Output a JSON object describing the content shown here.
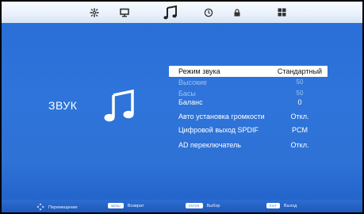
{
  "tabs": [
    {
      "icon": "gear-icon"
    },
    {
      "icon": "monitor-icon"
    },
    {
      "icon": "music-note-icon"
    },
    {
      "icon": "clock-icon"
    },
    {
      "icon": "lock-icon"
    },
    {
      "icon": "windows-grid-icon"
    }
  ],
  "section": {
    "title": "ЗВУК",
    "icon": "music-note-icon"
  },
  "menu": [
    {
      "label": "Режим звука",
      "value": "Стандартный",
      "selected": true,
      "dim": false
    },
    {
      "label": "Высокие",
      "value": "50",
      "selected": false,
      "dim": true
    },
    {
      "label": "Басы",
      "value": "50",
      "selected": false,
      "dim": true
    },
    {
      "label": "Баланс",
      "value": "0",
      "selected": false,
      "dim": false
    },
    {
      "label": "Авто установка громкости",
      "value": "Откл.",
      "selected": false,
      "dim": false
    },
    {
      "label": "Цифровой выход SPDIF",
      "value": "PCM",
      "selected": false,
      "dim": false
    },
    {
      "label": "AD переключатель",
      "value": "Откл.",
      "selected": false,
      "dim": false
    }
  ],
  "footer": {
    "move": {
      "label": "Перемещение"
    },
    "back": {
      "key": "MENU",
      "label": "Возврат"
    },
    "select": {
      "key": "ENTER",
      "label": "Выбор"
    },
    "exit": {
      "key": "EXIT",
      "label": "Выход"
    }
  },
  "colors": {
    "accent": "#2f72d6",
    "highlight": "#ffffff",
    "dim_text": "#9fc2ef"
  }
}
